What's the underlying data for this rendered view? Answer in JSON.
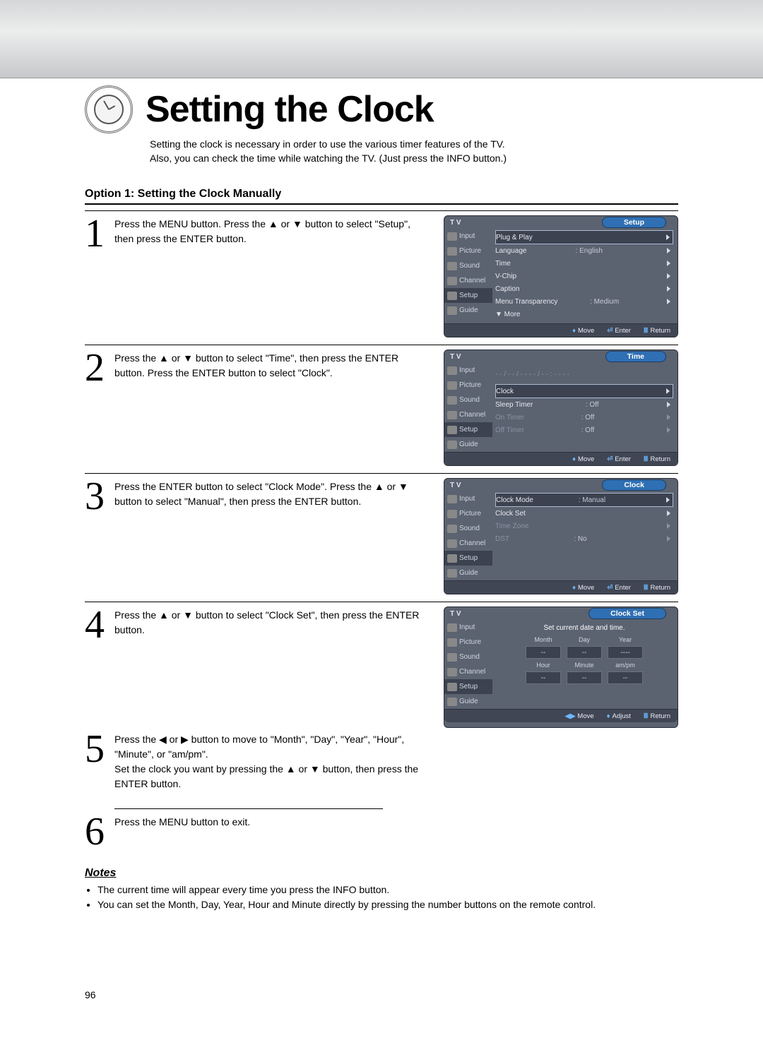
{
  "header": {
    "title": "Setting the Clock",
    "intro1": "Setting the clock is necessary in order to use the various timer features of the TV.",
    "intro2": "Also, you can check the time while watching the TV. (Just press the INFO button.)",
    "subhead": "Option 1: Setting the Clock Manually"
  },
  "steps": {
    "s1": "Press the MENU button. Press the ▲ or ▼ button to select \"Setup\", then press the ENTER button.",
    "s2": "Press the ▲ or ▼ button to select \"Time\", then press the ENTER button. Press the ENTER button to select \"Clock\".",
    "s3": "Press the ENTER button to select \"Clock Mode\". Press the ▲ or ▼ button to select \"Manual\", then press the ENTER button.",
    "s4": "Press the ▲ or ▼ button to select \"Clock Set\", then press the ENTER button.",
    "s5": "Press the ◀ or ▶ button to move to \"Month\", \"Day\", \"Year\", \"Hour\", \"Minute\", or \"am/pm\".\nSet the clock you want by pressing the ▲ or ▼ button, then press the ENTER button.",
    "s6": "Press the MENU button to exit."
  },
  "tabs": {
    "t1": "Input",
    "t2": "Picture",
    "t3": "Sound",
    "t4": "Channel",
    "t5": "Setup",
    "t6": "Guide"
  },
  "osd1": {
    "title": "Setup",
    "tv": "T V",
    "r1": "Plug & Play",
    "r2": "Language",
    "r2v": ": English",
    "r3": "Time",
    "r4": "V-Chip",
    "r5": "Caption",
    "r6": "Menu Transparency",
    "r6v": ": Medium",
    "r7": "▼ More"
  },
  "osd2": {
    "title": "Time",
    "timestr": "- - / - - / - - - - / - -  :  - -  - -",
    "r1": "Clock",
    "r2": "Sleep Timer",
    "r2v": ": Off",
    "r3": "On Timer",
    "r3v": ": Off",
    "r4": "Off Timer",
    "r4v": ": Off"
  },
  "osd3": {
    "title": "Clock",
    "r1": "Clock Mode",
    "r1v": ": Manual",
    "r2": "Clock Set",
    "r3": "Time Zone",
    "r4": "DST",
    "r4v": ": No"
  },
  "osd4": {
    "title": "Clock Set",
    "msg": "Set current date and time.",
    "c1": "Month",
    "c2": "Day",
    "c3": "Year",
    "c4": "Hour",
    "c5": "Minute",
    "c6": "am/pm",
    "v1": "--",
    "v2": "--",
    "v3": "----",
    "v4": "--",
    "v5": "--",
    "v6": "--"
  },
  "foot": {
    "move": "Move",
    "enter": "Enter",
    "return": "Return",
    "adjust": "Adjust",
    "moveIcon": "♦",
    "enterIcon": "⏎",
    "returnIcon": "�ولينا",
    "lrIcon": "◀▶",
    "udIcon": "♦"
  },
  "notes": {
    "h": "Notes",
    "n1": "The current time will appear every time you press the INFO button.",
    "n2": "You can set the Month, Day, Year, Hour and Minute directly by pressing the number buttons on the remote control."
  },
  "page": "96"
}
